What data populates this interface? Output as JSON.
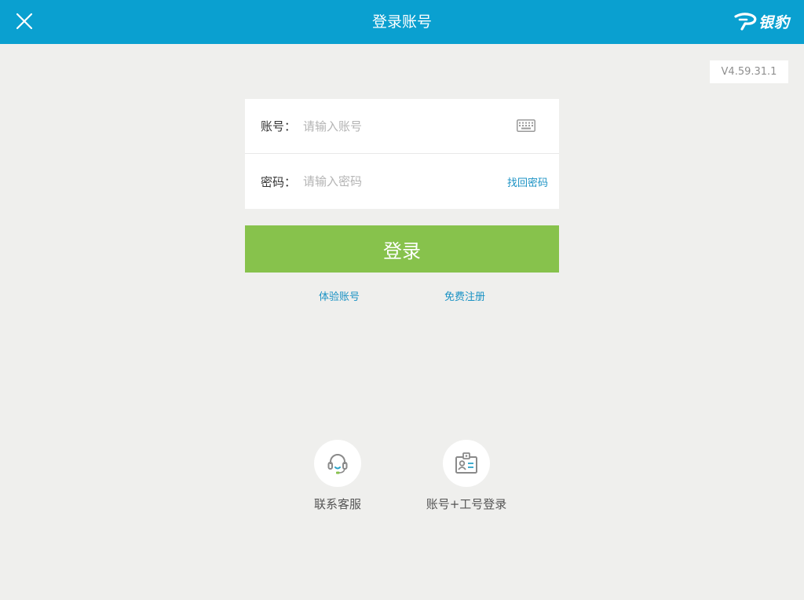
{
  "header": {
    "title": "登录账号",
    "brand_name": "银豹"
  },
  "version": "V4.59.31.1",
  "form": {
    "account_label": "账号：",
    "account_placeholder": "请输入账号",
    "account_value": "",
    "password_label": "密码：",
    "password_placeholder": "请输入密码",
    "password_value": "",
    "forgot_link": "找回密码"
  },
  "login_button": "登录",
  "links": {
    "trial": "体验账号",
    "register": "免费注册"
  },
  "quick_actions": [
    {
      "label": "联系客服",
      "icon": "headset-icon"
    },
    {
      "label": "账号+工号登录",
      "icon": "id-card-icon"
    }
  ],
  "colors": {
    "header": "#0aa0d0",
    "background": "#efefed",
    "login_button": "#87c24c",
    "link": "#1a92c4",
    "icon_accent": "#2ba3c9"
  },
  "icons": {
    "close": "close-icon",
    "brand": "brand-logo-icon",
    "keyboard": "keyboard-icon"
  }
}
